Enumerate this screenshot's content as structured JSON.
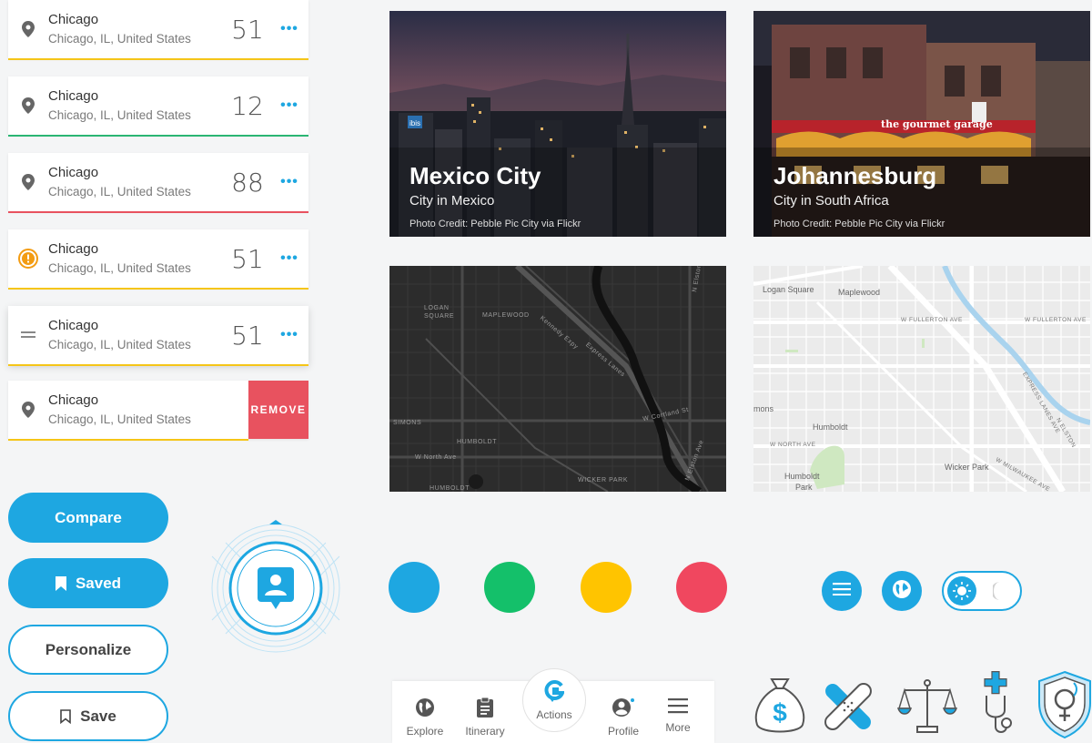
{
  "cards": [
    {
      "city": "Chicago",
      "location": "Chicago, IL, United States",
      "count": "51",
      "more": "•••",
      "bar_color": "#f5c518"
    },
    {
      "city": "Chicago",
      "location": "Chicago, IL, United States",
      "count": "12",
      "more": "•••",
      "bar_color": "#2bb573"
    },
    {
      "city": "Chicago",
      "location": "Chicago, IL, United States",
      "count": "88",
      "more": "•••",
      "bar_color": "#e8525f"
    },
    {
      "city": "Chicago",
      "location": "Chicago, IL, United States",
      "count": "51",
      "more": "•••",
      "bar_color": "#f5c518"
    },
    {
      "city": "Chicago",
      "location": "Chicago, IL, United States",
      "count": "51",
      "more": "•••",
      "bar_color": "#f5c518"
    },
    {
      "city": "Chicago",
      "location": "Chicago, IL, United States",
      "remove_label": "REMOVE",
      "bar_color": "#f5c518"
    }
  ],
  "photos": [
    {
      "title": "Mexico City",
      "subtitle": "City in Mexico",
      "credit": "Photo Credit: Pebble Pic City via Flickr"
    },
    {
      "title": "Johannesburg",
      "subtitle": "City in South Africa",
      "credit": "Photo Credit: Pebble Pic City via Flickr"
    }
  ],
  "photo_signs": {
    "hotel": "ibis",
    "restaurant": "the gourmet garage"
  },
  "map_dark": {
    "labels": [
      "LOGAN",
      "SQUARE",
      "MAPLEWOOD",
      "Kennedy Expy",
      "Express Lanes",
      "W Cortland St",
      "N Elston Ave",
      "SIMONS",
      "HUMBOLDT",
      "W North Ave",
      "WICKER PARK",
      "HUMBOLDT",
      "N Elston Ave"
    ]
  },
  "map_light": {
    "labels": [
      "Logan Square",
      "Maplewood",
      "W FULLERTON AVE",
      "W FULLERTON AVE",
      "mons",
      "Humboldt",
      "W NORTH AVE",
      "Humboldt",
      "Park",
      "Wicker Park",
      "W MILWAUKEE AVE",
      "EXPRESS LANES",
      "N ELSTON AVE"
    ]
  },
  "buttons": {
    "compare": "Compare",
    "saved": "Saved",
    "personalize": "Personalize",
    "save": "Save"
  },
  "swatches": [
    "#1ea7e1",
    "#14c06a",
    "#ffc400",
    "#f0475f"
  ],
  "accent": "#1ea7e1",
  "nav": {
    "items": [
      {
        "label": "Explore",
        "icon": "globe-icon"
      },
      {
        "label": "Itinerary",
        "icon": "clipboard-icon"
      },
      {
        "label": "Actions",
        "icon": "g-logo-icon"
      },
      {
        "label": "Profile",
        "icon": "person-icon"
      },
      {
        "label": "More",
        "icon": "menu-icon"
      }
    ]
  },
  "illustrations": [
    "money-bag-icon",
    "bandage-icon",
    "scales-icon",
    "stethoscope-icon",
    "shield-female-icon"
  ]
}
